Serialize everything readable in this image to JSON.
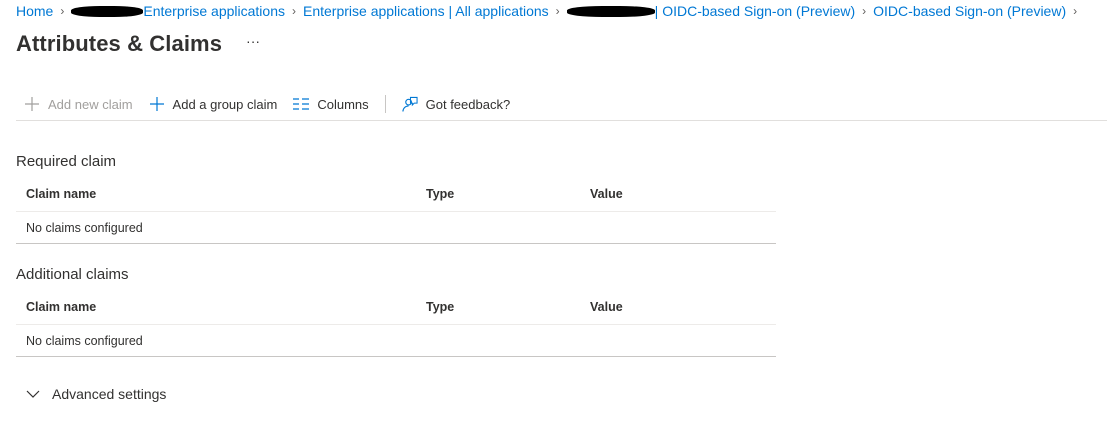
{
  "breadcrumb": {
    "items": [
      {
        "label": "Home"
      },
      {
        "label": "Enterprise applications"
      },
      {
        "label": "Enterprise applications | All applications"
      },
      {
        "label": "| OIDC-based Sign-on (Preview)"
      },
      {
        "label": "OIDC-based Sign-on (Preview)"
      }
    ]
  },
  "header": {
    "title": "Attributes & Claims",
    "more_label": "···"
  },
  "toolbar": {
    "add_new_claim": "Add new claim",
    "add_group_claim": "Add a group claim",
    "columns": "Columns",
    "feedback": "Got feedback?"
  },
  "required_section": {
    "title": "Required claim",
    "columns": {
      "name": "Claim name",
      "type": "Type",
      "value": "Value"
    },
    "empty_message": "No claims configured"
  },
  "additional_section": {
    "title": "Additional claims",
    "columns": {
      "name": "Claim name",
      "type": "Type",
      "value": "Value"
    },
    "empty_message": "No claims configured"
  },
  "advanced": {
    "label": "Advanced settings"
  },
  "icons": {
    "plus": "plus-icon",
    "columns": "columns-icon",
    "feedback": "feedback-icon",
    "chevron": "chevron-down-icon",
    "separator": "chevron-right-icon"
  },
  "colors": {
    "link": "#0078d4",
    "text": "#323130",
    "disabled": "#a19f9d",
    "divider": "#e1dfdd"
  }
}
